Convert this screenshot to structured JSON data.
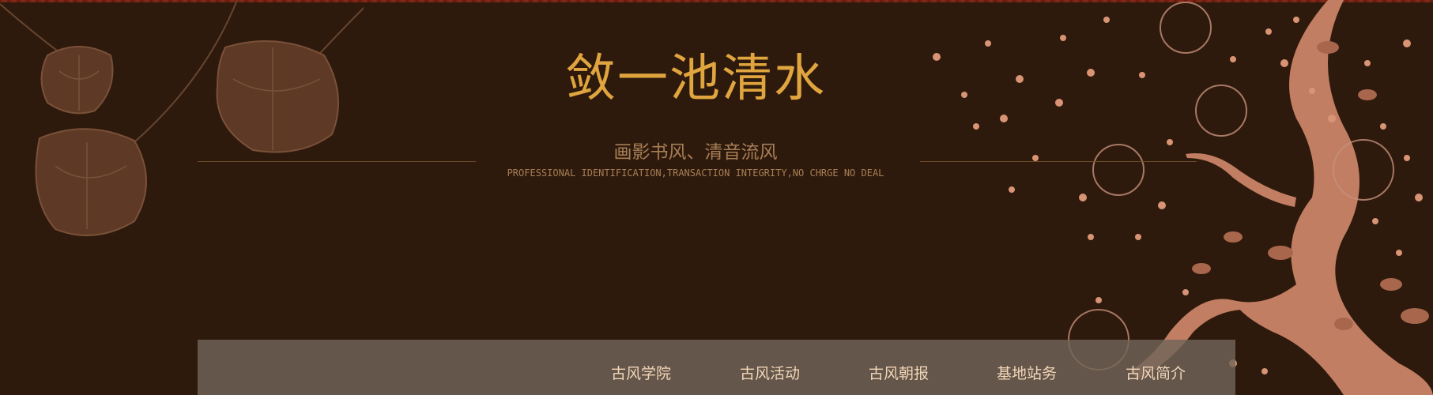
{
  "header": {
    "title": "敛一池清水",
    "subtitle": "画影书风、清音流风",
    "tagline": "PROFESSIONAL IDENTIFICATION,TRANSACTION INTEGRITY,NO CHRGE NO DEAL"
  },
  "nav": {
    "items": [
      {
        "label": "古风学院"
      },
      {
        "label": "古风活动"
      },
      {
        "label": "古风朝报"
      },
      {
        "label": "基地站务"
      },
      {
        "label": "古风简介"
      }
    ]
  },
  "colors": {
    "background": "#2e1a0c",
    "title": "#e0a53f",
    "subtitle": "#a77e55",
    "nav_bg": "#706458",
    "nav_text": "#f2d6b8",
    "petal": "#d89474"
  }
}
